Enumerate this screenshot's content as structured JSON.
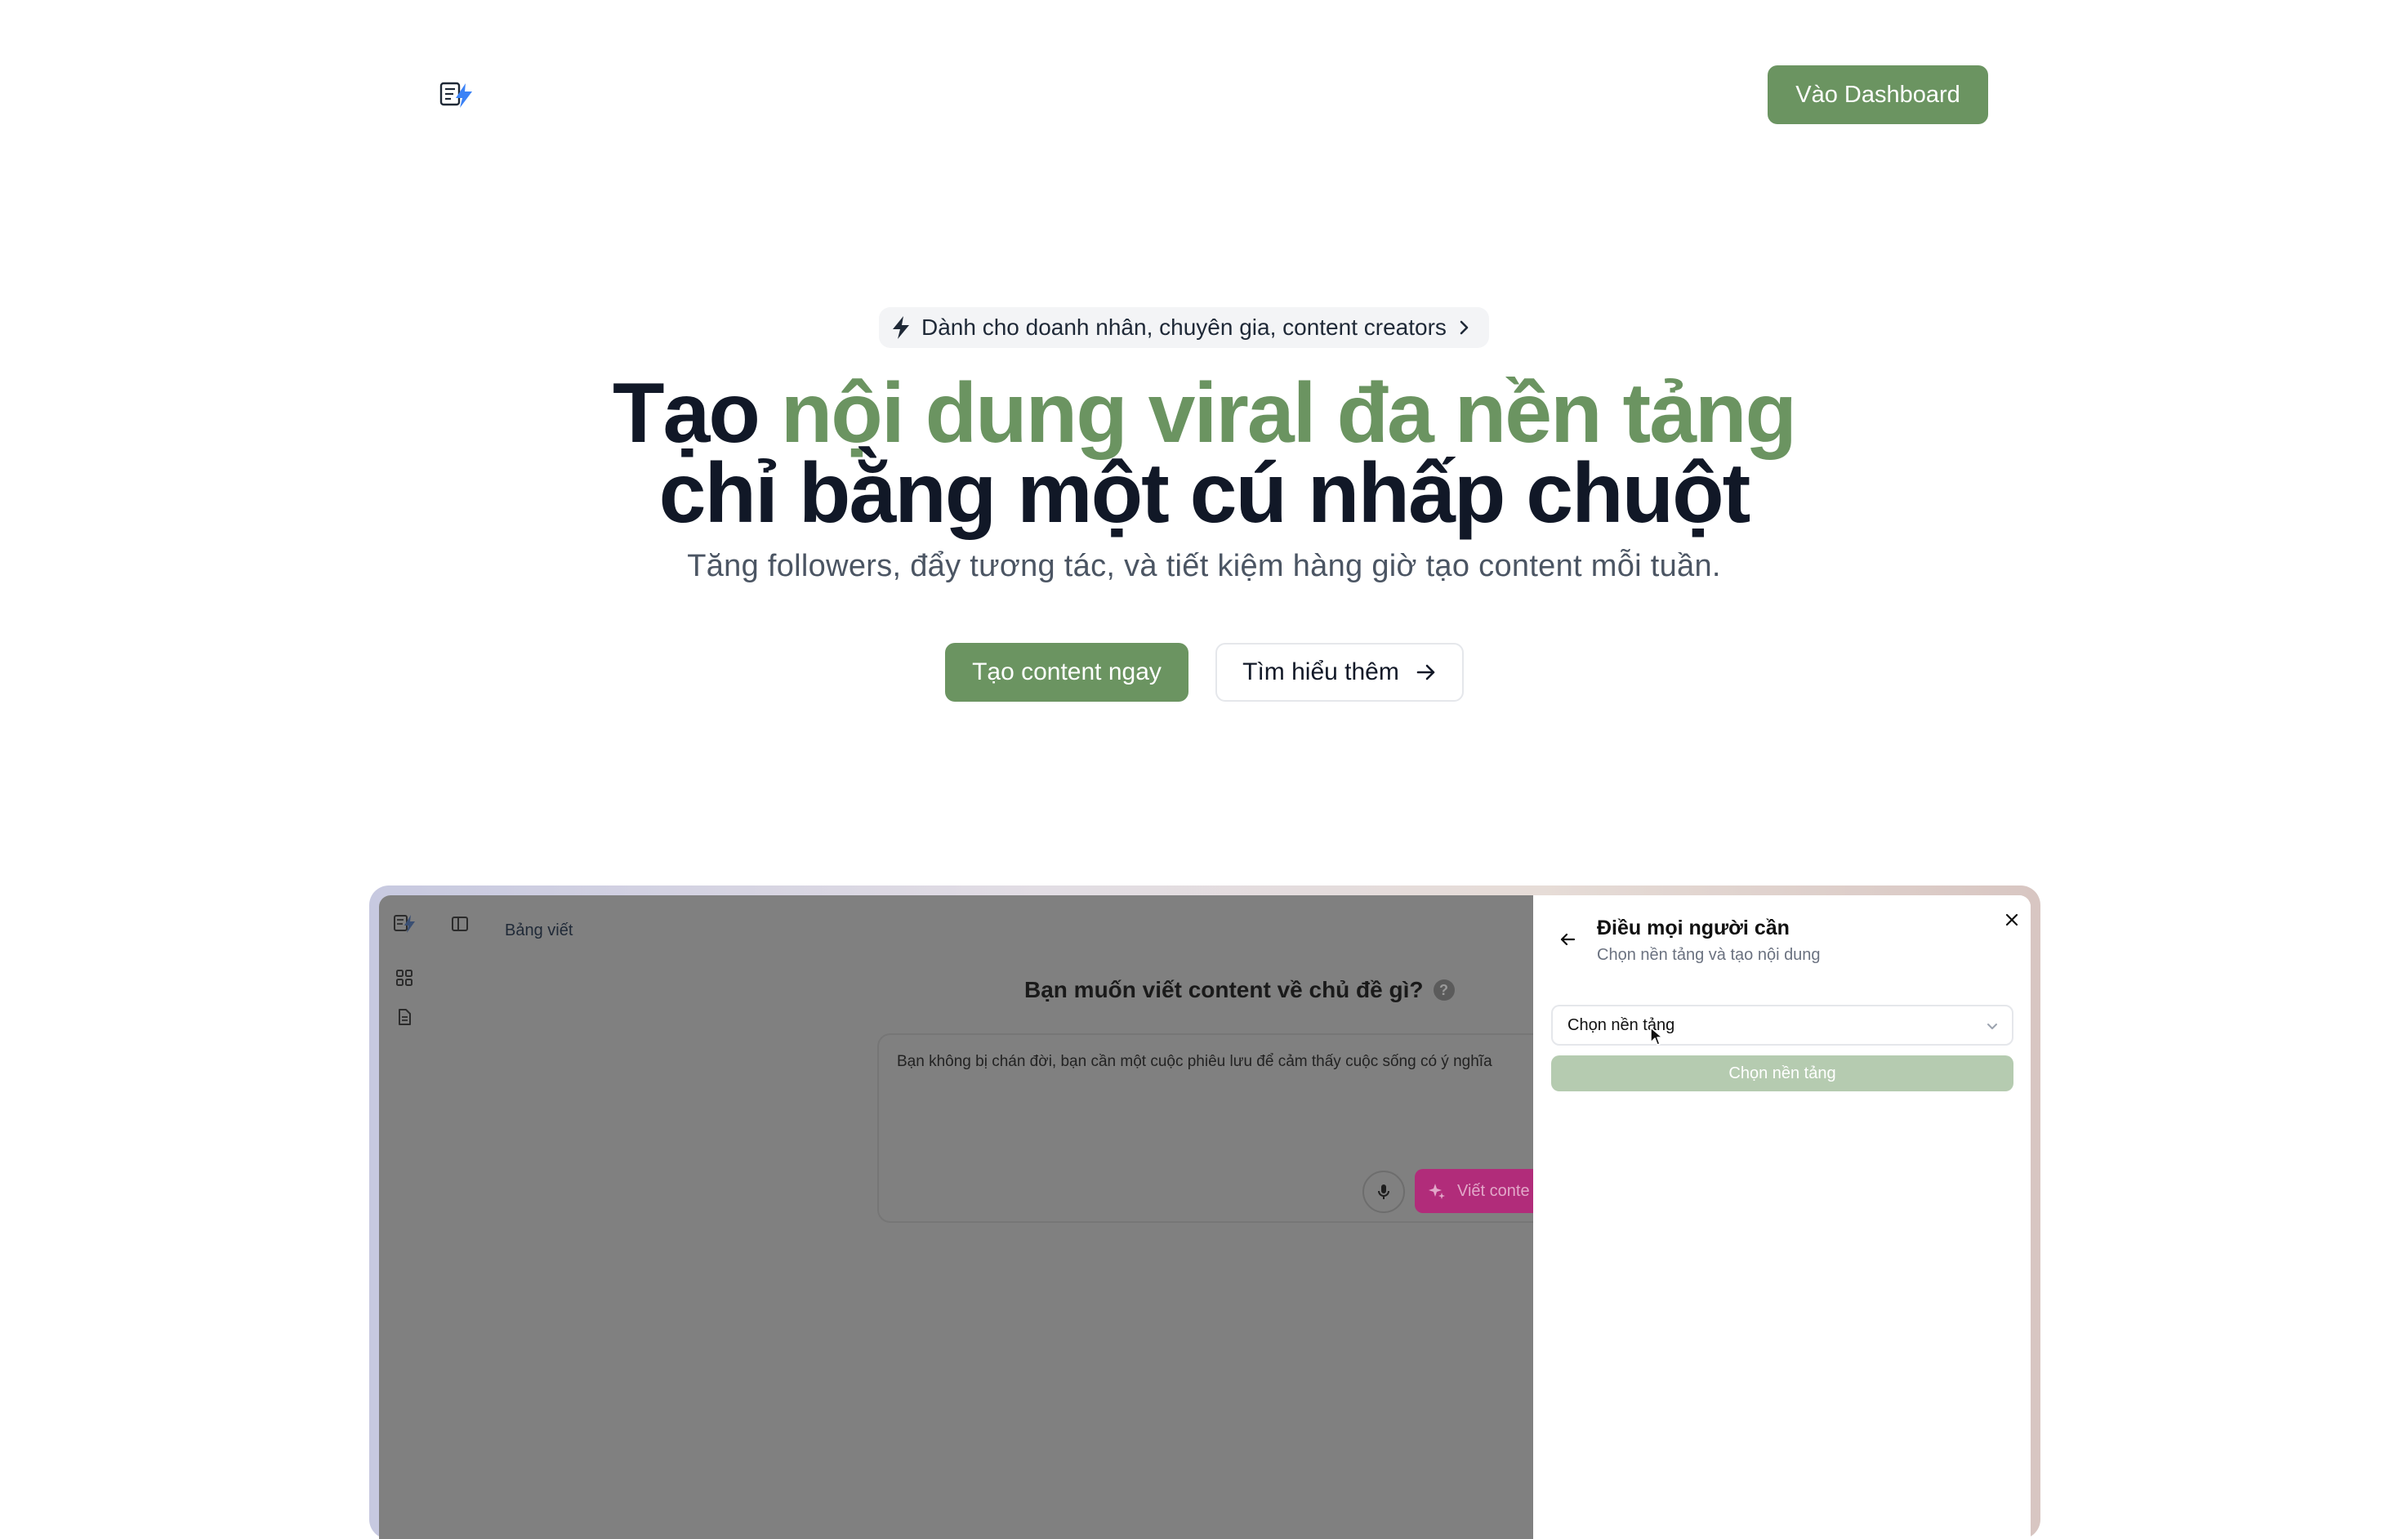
{
  "header": {
    "logo_icon": "note-bolt-icon",
    "dashboard_button": "Vào Dashboard"
  },
  "hero": {
    "badge_icon": "bolt-icon",
    "badge_text": "Dành cho doanh nhân, chuyên gia, content creators",
    "badge_arrow_icon": "chevron-right-icon",
    "title_line1_prefix": "Tạo",
    "title_line1_accent": "nội dung viral đa nền tảng",
    "title_line2": "chỉ bằng một cú nhấp chuột",
    "subtitle": "Tăng followers, đẩy tương tác, và tiết kiệm hàng giờ tạo content mỗi tuần.",
    "cta_primary": "Tạo content ngay",
    "cta_secondary": "Tìm hiểu thêm",
    "accent_color": "#6b9461"
  },
  "preview": {
    "breadcrumb": "Bảng viết",
    "question": "Bạn muốn viết content về chủ đề gì?",
    "help_mark": "?",
    "prompt_text": "Bạn không bị chán đời, bạn cần một cuộc phiêu lưu để cảm thấy cuộc sống có ý nghĩa",
    "write_button": "Viết conte",
    "panel": {
      "title": "Điều mọi người cần",
      "subtitle": "Chọn nền tảng và tạo nội dung",
      "select_value": "Chọn nền tảng",
      "submit_button": "Chọn nền tảng"
    }
  }
}
